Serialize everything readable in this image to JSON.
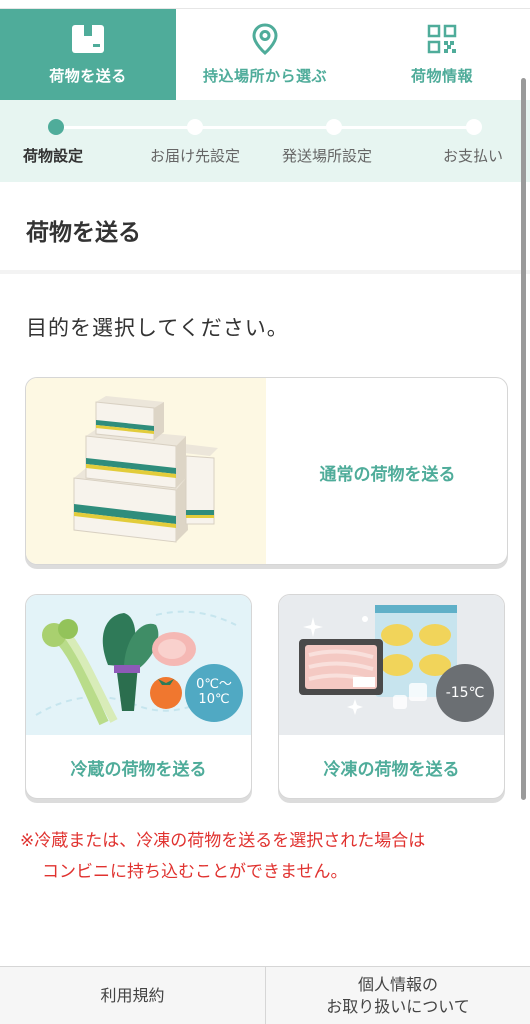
{
  "nav": {
    "tabs": [
      {
        "label": "荷物を送る",
        "icon": "box-icon",
        "active": true
      },
      {
        "label": "持込場所から選ぶ",
        "icon": "location-pin-icon",
        "active": false
      },
      {
        "label": "荷物情報",
        "icon": "qr-code-icon",
        "active": false
      }
    ]
  },
  "steps": {
    "items": [
      {
        "label": "荷物設定",
        "active": true
      },
      {
        "label": "お届け先設定",
        "active": false
      },
      {
        "label": "発送場所設定",
        "active": false
      },
      {
        "label": "お支払い",
        "active": false
      }
    ]
  },
  "page": {
    "title": "荷物を送る",
    "prompt": "目的を選択してください。"
  },
  "options": {
    "normal": {
      "label": "通常の荷物を送る"
    },
    "chilled": {
      "label": "冷蔵の荷物を送る",
      "badge": "0℃〜10℃"
    },
    "frozen": {
      "label": "冷凍の荷物を送る",
      "badge": "-15℃"
    }
  },
  "notice": {
    "line1": "※冷蔵または、冷凍の荷物を送るを選択された場合は",
    "line2": "コンビニに持ち込むことができません。"
  },
  "footer": {
    "terms": "利用規約",
    "privacy_line1": "個人情報の",
    "privacy_line2": "お取り扱いについて"
  },
  "colors": {
    "accent": "#4fac9a",
    "step_bg": "#e7f5f1",
    "notice": "#e0322f"
  }
}
